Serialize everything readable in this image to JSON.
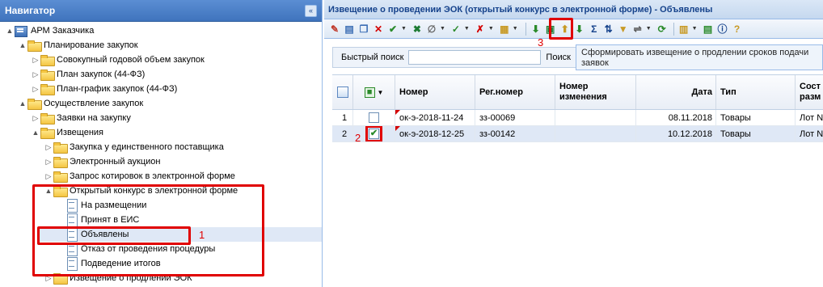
{
  "navigator": {
    "title": "Навигатор",
    "collapse_icon": "«",
    "nodes": [
      {
        "label": "АРМ Заказчика",
        "icon": "root",
        "expander": "▲"
      },
      {
        "label": "Планирование закупок",
        "icon": "folder",
        "expander": "▲"
      },
      {
        "label": "Совокупный годовой объем закупок",
        "icon": "folder",
        "expander": "▷"
      },
      {
        "label": "План закупок (44-ФЗ)",
        "icon": "folder",
        "expander": "▷"
      },
      {
        "label": "План-график закупок (44-ФЗ)",
        "icon": "folder",
        "expander": "▷"
      },
      {
        "label": "Осуществление закупок",
        "icon": "folder",
        "expander": "▲"
      },
      {
        "label": "Заявки на закупку",
        "icon": "folder",
        "expander": "▷"
      },
      {
        "label": "Извещения",
        "icon": "folder",
        "expander": "▲"
      },
      {
        "label": "Закупка у единственного поставщика",
        "icon": "folder",
        "expander": "▷"
      },
      {
        "label": "Электронный аукцион",
        "icon": "folder",
        "expander": "▷"
      },
      {
        "label": "Запрос котировок в электронной форме",
        "icon": "folder",
        "expander": "▷"
      },
      {
        "label": "Открытый конкурс в электронной форме",
        "icon": "folder",
        "expander": "▲"
      },
      {
        "label": "На размещении",
        "icon": "doc",
        "expander": ""
      },
      {
        "label": "Принят в ЕИС",
        "icon": "doc",
        "expander": ""
      },
      {
        "label": "Объявлены",
        "icon": "doc",
        "expander": "",
        "selected": true
      },
      {
        "label": "Отказ от проведения процедуры",
        "icon": "doc",
        "expander": ""
      },
      {
        "label": "Подведение итогов",
        "icon": "doc",
        "expander": ""
      },
      {
        "label": "Извещение о продлении ЭОК",
        "icon": "folder",
        "expander": "▷"
      }
    ]
  },
  "annotations": {
    "n1": "1",
    "n2": "2",
    "n3": "3"
  },
  "main": {
    "title": "Извещение о проведении ЭОК (открытый конкурс в электронной форме) - Объявлены",
    "toolbar_icons": [
      {
        "name": "edit-icon",
        "glyph": "✎",
        "color": "#c0392b",
        "arrow": false
      },
      {
        "name": "add-icon",
        "glyph": "▤",
        "color": "#3b6db4",
        "arrow": false
      },
      {
        "name": "copy-icon",
        "glyph": "❐",
        "color": "#3b6db4",
        "arrow": false
      },
      {
        "name": "delete-icon",
        "glyph": "✕",
        "color": "#d40000",
        "arrow": false
      },
      {
        "name": "approve-icon",
        "glyph": "✔",
        "color": "#2a8a2a",
        "arrow": true
      },
      {
        "name": "excel-icon",
        "glyph": "✖",
        "color": "#1e7b34",
        "arrow": false
      },
      {
        "name": "attach-icon",
        "glyph": "∅",
        "color": "#666",
        "arrow": true
      },
      {
        "name": "check-icon",
        "glyph": "✓",
        "color": "#2a8a2a",
        "arrow": true
      },
      {
        "name": "reject-icon",
        "glyph": "✗",
        "color": "#d40000",
        "arrow": true
      },
      {
        "name": "document-icon",
        "glyph": "▦",
        "color": "#c89a26",
        "arrow": true
      },
      {
        "name": "generate-extension-icon",
        "glyph": "⬇",
        "color": "#2a8a2a",
        "arrow": false
      },
      {
        "name": "export-icon",
        "glyph": "▣",
        "color": "#1e7b34",
        "arrow": false
      },
      {
        "name": "upload-icon",
        "glyph": "⬆",
        "color": "#c89a26",
        "arrow": false
      },
      {
        "name": "download-icon",
        "glyph": "⬇",
        "color": "#2a8a2a",
        "arrow": false
      },
      {
        "name": "sum-icon",
        "glyph": "Σ",
        "color": "#15428b",
        "arrow": false
      },
      {
        "name": "sort-icon",
        "glyph": "⇅",
        "color": "#15428b",
        "arrow": false
      },
      {
        "name": "filter-icon",
        "glyph": "▼",
        "color": "#c89a26",
        "arrow": false
      },
      {
        "name": "link-icon",
        "glyph": "⇌",
        "color": "#555",
        "arrow": true
      },
      {
        "name": "refresh-icon",
        "glyph": "⟳",
        "color": "#2a8a2a",
        "arrow": false
      },
      {
        "name": "print-icon",
        "glyph": "▥",
        "color": "#c89a26",
        "arrow": true
      },
      {
        "name": "report-icon",
        "glyph": "▤",
        "color": "#2a8a2a",
        "arrow": false
      },
      {
        "name": "info-icon",
        "glyph": "ⓘ",
        "color": "#15428b",
        "arrow": false
      },
      {
        "name": "help-icon",
        "glyph": "?",
        "color": "#c89a26",
        "arrow": false
      }
    ],
    "search": {
      "label": "Быстрый поиск",
      "value": "",
      "label2": "Поиск"
    },
    "tooltip": "Сформировать извещение о продлении сроков подачи заявок",
    "columns": [
      "",
      "",
      "Номер",
      "Рег.номер",
      "Номер изменения",
      "Дата",
      "Тип",
      "Сост разм"
    ],
    "rows": [
      {
        "n": "1",
        "checked": false,
        "number": "ок-э-2018-11-24",
        "reg": "зз-00069",
        "change": "",
        "date": "08.11.2018",
        "type": "Товары",
        "state": "Лот N"
      },
      {
        "n": "2",
        "checked": true,
        "number": "ок-э-2018-12-25",
        "reg": "зз-00142",
        "change": "",
        "date": "10.12.2018",
        "type": "Товары",
        "state": "Лот N"
      }
    ]
  }
}
